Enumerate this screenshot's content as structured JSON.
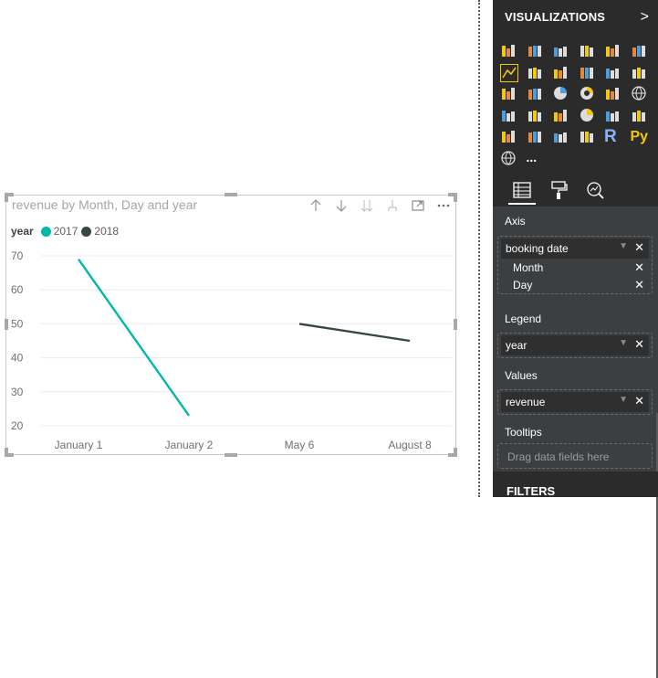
{
  "visual": {
    "title": "revenue by Month, Day and year",
    "toolbar_icons": [
      "arrow-up-icon",
      "arrow-down-icon",
      "double-arrow-down-icon",
      "expand-hierarchy-icon",
      "focus-mode-icon",
      "more-options-icon"
    ],
    "legend": {
      "title": "year",
      "items": [
        {
          "label": "2017",
          "color": "#01b8aa"
        },
        {
          "label": "2018",
          "color": "#374649"
        }
      ]
    }
  },
  "chart_data": {
    "type": "line",
    "title": "revenue by Month, Day and year",
    "categories": [
      "January 1",
      "January 2",
      "May 6",
      "August 8"
    ],
    "series": [
      {
        "name": "2017",
        "color": "#01b8aa",
        "values": [
          69,
          23,
          null,
          null
        ]
      },
      {
        "name": "2018",
        "color": "#374649",
        "values": [
          null,
          null,
          50,
          45
        ]
      }
    ],
    "y_ticks": [
      70,
      60,
      50,
      40,
      30,
      20
    ],
    "ylim": [
      20,
      70
    ],
    "grid": true,
    "legend_position": "top-left"
  },
  "pane": {
    "title": "VISUALIZATIONS",
    "chevron": ">",
    "r_label": "R",
    "py_label": "Py",
    "more_label": "...",
    "sections": {
      "axis": "Axis",
      "legend": "Legend",
      "values": "Values",
      "tooltips": "Tooltips"
    },
    "axis_field": "booking date",
    "axis_subfields": [
      "Month",
      "Day"
    ],
    "legend_field": "year",
    "values_field": "revenue",
    "tooltips_placeholder": "Drag data fields here",
    "remove_glyph": "✕",
    "dropdown_glyph": "▼",
    "filters_title": "FILTERS"
  }
}
